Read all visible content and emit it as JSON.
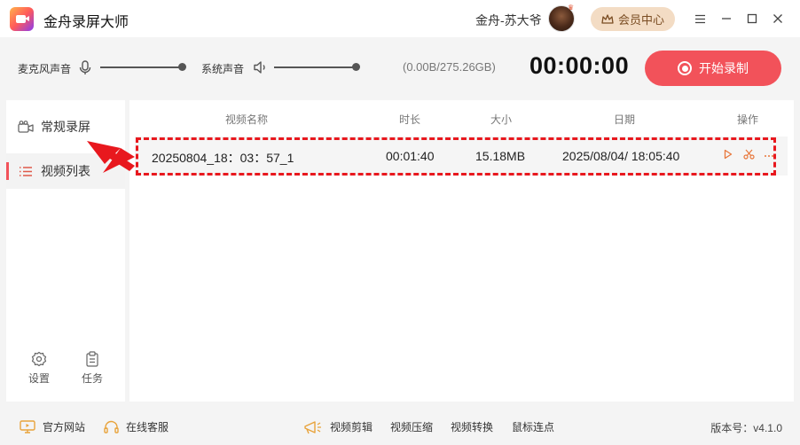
{
  "app": {
    "title": "金舟录屏大师"
  },
  "header": {
    "user_name": "金舟-苏大爷",
    "vip_label": "会员中心",
    "avatar_badge": "♛"
  },
  "controls": {
    "mic_label": "麦克风声音",
    "system_label": "系统声音",
    "mic_level": 1.0,
    "system_level": 1.0,
    "storage": "(0.00B/275.26GB)",
    "timer": "00:00:00",
    "record_label": "开始录制"
  },
  "sidebar": {
    "items": [
      {
        "label": "常规录屏",
        "icon": "camera-icon"
      },
      {
        "label": "视频列表",
        "icon": "list-icon"
      }
    ],
    "bottom": [
      {
        "label": "设置",
        "icon": "gear-icon"
      },
      {
        "label": "任务",
        "icon": "clipboard-icon"
      }
    ]
  },
  "table": {
    "headers": {
      "name": "视频名称",
      "duration": "时长",
      "size": "大小",
      "date": "日期",
      "ops": "操作"
    },
    "rows": [
      {
        "name": "20250804_18：03：57_1",
        "duration": "00:01:40",
        "size": "15.18MB",
        "date": "2025/08/04/ 18:05:40"
      }
    ],
    "op_icons": [
      "play-icon",
      "scissors-icon",
      "more-icon"
    ]
  },
  "footer": {
    "website": "官方网站",
    "support": "在线客服",
    "tools": [
      "视频剪辑",
      "视频压缩",
      "视频转换",
      "鼠标连点"
    ],
    "version": "版本号：v4.1.0"
  },
  "colors": {
    "accent": "#f2525a",
    "highlight": "#e8181e",
    "op": "#e8773b",
    "vip_bg": "#f3dcc4"
  }
}
